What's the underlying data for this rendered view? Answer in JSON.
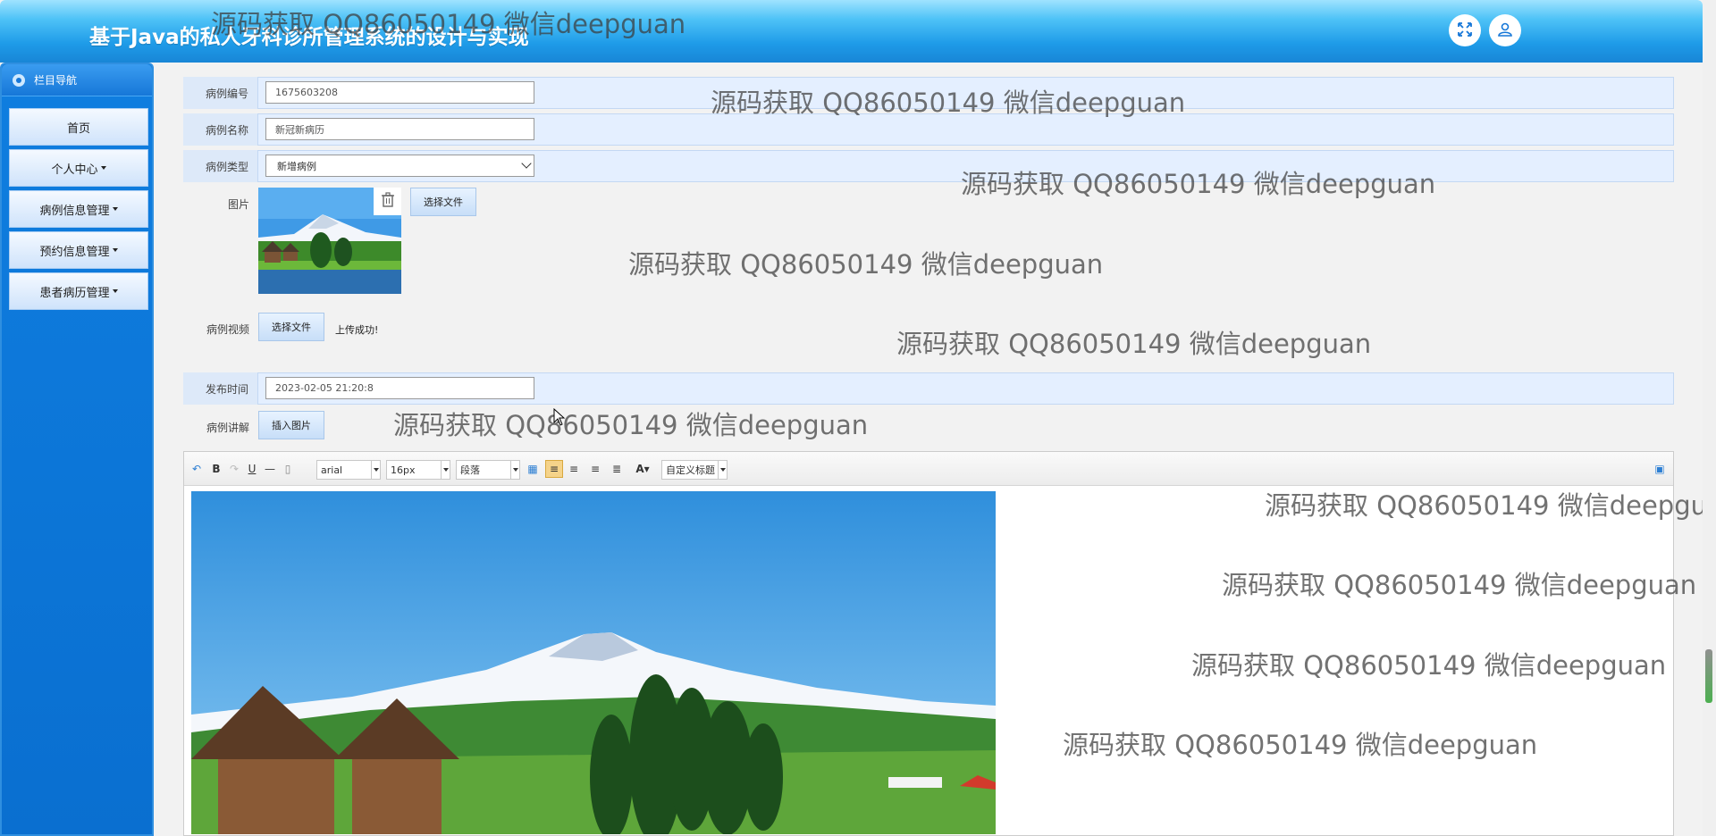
{
  "header": {
    "title": "基于Java的私人牙科诊所管理系统的设计与实现",
    "fullscreen_icon": "fullscreen-icon",
    "user_icon": "user-icon"
  },
  "sidebar": {
    "heading": "栏目导航",
    "items": [
      {
        "label": "首页",
        "dropdown": false
      },
      {
        "label": "个人中心",
        "dropdown": true
      },
      {
        "label": "病例信息管理",
        "dropdown": true
      },
      {
        "label": "预约信息管理",
        "dropdown": true
      },
      {
        "label": "患者病历管理",
        "dropdown": true
      }
    ]
  },
  "form": {
    "case_number": {
      "label": "病例编号",
      "value": "1675603208"
    },
    "case_name": {
      "label": "病例名称",
      "value": "新冠新病历"
    },
    "case_type": {
      "label": "病例类型",
      "selected": "新增病例"
    },
    "image": {
      "label": "图片",
      "button": "选择文件"
    },
    "video": {
      "label": "病例视频",
      "button": "选择文件",
      "status": "上传成功!"
    },
    "publish_time": {
      "label": "发布时间",
      "value": "2023-02-05 21:20:8"
    },
    "explanation": {
      "label": "病例讲解",
      "button": "插入图片"
    }
  },
  "editor": {
    "font_family": "arial",
    "font_size": "16px",
    "paragraph": "段落",
    "custom_title": "自定义标题"
  },
  "watermark": "源码获取 QQ86050149 微信deepguan",
  "colors": {
    "header_blue": "#1e9be8",
    "sidebar_blue": "#0f7ee0",
    "band_blue": "#e4efff"
  }
}
